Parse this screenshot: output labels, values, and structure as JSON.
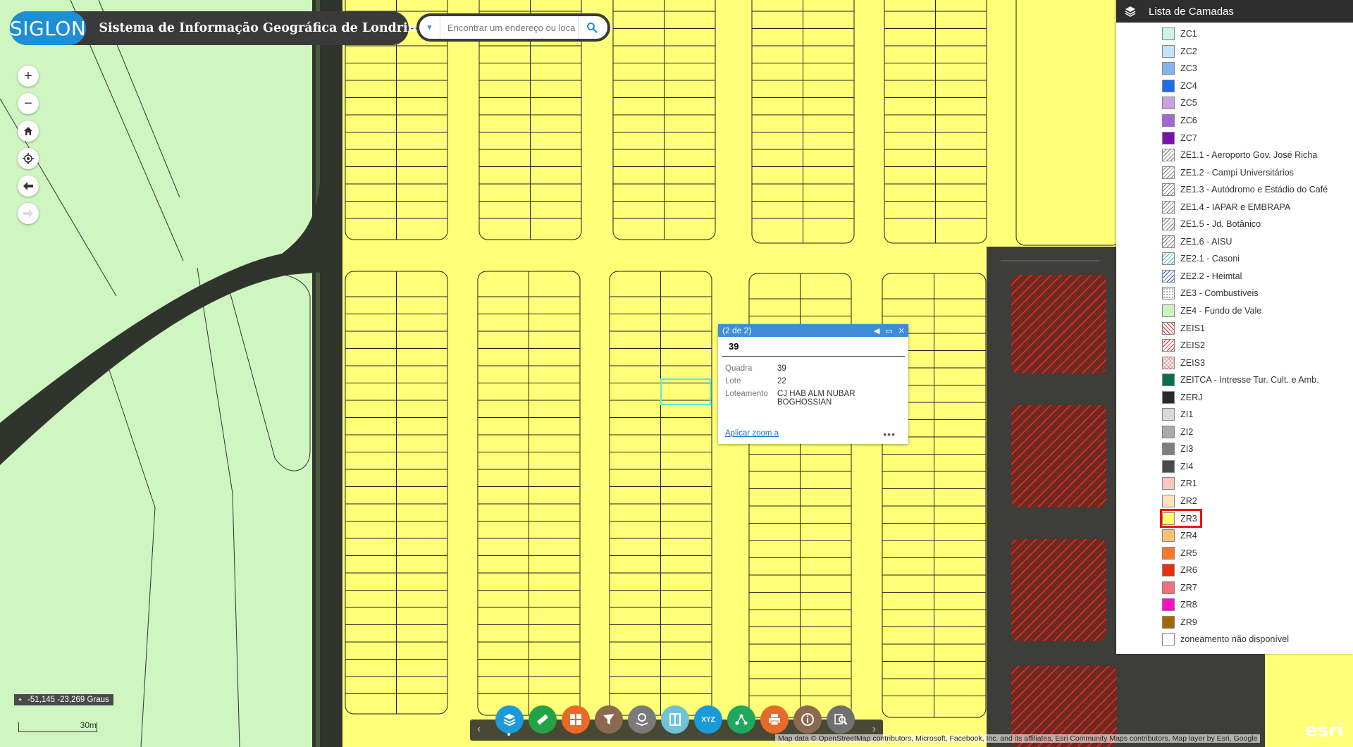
{
  "header": {
    "logo_text": "SIGLON",
    "title": "Sistema de Informação Geográfica de Londrina"
  },
  "search": {
    "placeholder": "Encontrar um endereço ou loca"
  },
  "controls": {
    "zoom_in": "+",
    "zoom_out": "−"
  },
  "popup": {
    "counter": "(2 de 2)",
    "title": "39",
    "fields": [
      {
        "key": "Quadra",
        "value": "39"
      },
      {
        "key": "Lote",
        "value": "22"
      },
      {
        "key": "Loteamento",
        "value": "CJ HAB ALM NUBAR BOGHOSSIAN"
      }
    ],
    "zoom_link": "Aplicar zoom a",
    "more": "•••"
  },
  "layer_list": {
    "title": "Lista de Camadas",
    "items": [
      {
        "label": "ZC1",
        "color": "#c8f5e6",
        "pattern": "solid"
      },
      {
        "label": "ZC2",
        "color": "#bfe4fb",
        "pattern": "solid"
      },
      {
        "label": "ZC3",
        "color": "#7fb6ee",
        "pattern": "solid"
      },
      {
        "label": "ZC4",
        "color": "#1e6ee8",
        "pattern": "solid"
      },
      {
        "label": "ZC5",
        "color": "#c9a0e0",
        "pattern": "solid"
      },
      {
        "label": "ZC6",
        "color": "#a468d4",
        "pattern": "solid"
      },
      {
        "label": "ZC7",
        "color": "#7a10b0",
        "pattern": "solid"
      },
      {
        "label": "ZE1.1 - Aeroporto Gov. José Richa",
        "color": "#777777",
        "pattern": "hatch"
      },
      {
        "label": "ZE1.2 - Campi Universitários",
        "color": "#777777",
        "pattern": "hatch"
      },
      {
        "label": "ZE1.3 - Autódromo e Estádio do Café",
        "color": "#777777",
        "pattern": "hatch"
      },
      {
        "label": "ZE1.4 - IAPAR e EMBRAPA",
        "color": "#777777",
        "pattern": "hatch"
      },
      {
        "label": "ZE1.5 - Jd. Botânico",
        "color": "#777777",
        "pattern": "hatch"
      },
      {
        "label": "ZE1.6 - AISU",
        "color": "#777777",
        "pattern": "hatch"
      },
      {
        "label": "ZE2.1 - Casoni",
        "color": "#3bb7d9",
        "pattern": "hatch"
      },
      {
        "label": "ZE2.2 - Heimtal",
        "color": "#1d56c9",
        "pattern": "hatch"
      },
      {
        "label": "ZE3 - Combustíveis",
        "color": "#888888",
        "pattern": "dots"
      },
      {
        "label": "ZE4 - Fundo de Vale",
        "color": "#cdf5c0",
        "pattern": "solid"
      },
      {
        "label": "ZEIS1",
        "color": "#e02020",
        "pattern": "hatch-rev"
      },
      {
        "label": "ZEIS2",
        "color": "#e02020",
        "pattern": "hatch"
      },
      {
        "label": "ZEIS3",
        "color": "#f08080",
        "pattern": "cross"
      },
      {
        "label": "ZEITCA - Intresse Tur. Cult. e Amb.",
        "color": "#0a6e4a",
        "pattern": "solid"
      },
      {
        "label": "ZERJ",
        "color": "#2a2a2a",
        "pattern": "solid"
      },
      {
        "label": "ZI1",
        "color": "#d9d9d9",
        "pattern": "solid"
      },
      {
        "label": "ZI2",
        "color": "#aaaaaa",
        "pattern": "solid"
      },
      {
        "label": "ZI3",
        "color": "#7e7e7e",
        "pattern": "solid"
      },
      {
        "label": "ZI4",
        "color": "#4a4a4a",
        "pattern": "solid"
      },
      {
        "label": "ZR1",
        "color": "#f8c8c0",
        "pattern": "solid"
      },
      {
        "label": "ZR2",
        "color": "#fde3c0",
        "pattern": "solid"
      },
      {
        "label": "ZR3",
        "color": "#ffff70",
        "pattern": "solid"
      },
      {
        "label": "ZR4",
        "color": "#fbc070",
        "pattern": "solid"
      },
      {
        "label": "ZR5",
        "color": "#f57a30",
        "pattern": "solid"
      },
      {
        "label": "ZR6",
        "color": "#e83010",
        "pattern": "solid"
      },
      {
        "label": "ZR7",
        "color": "#f07080",
        "pattern": "solid"
      },
      {
        "label": "ZR8",
        "color": "#ff10c8",
        "pattern": "solid"
      },
      {
        "label": "ZR9",
        "color": "#a06a00",
        "pattern": "solid"
      },
      {
        "label": "zoneamento não disponível",
        "color": "#ffffff",
        "pattern": "solid"
      }
    ]
  },
  "coordinates": "-51,145 -23,269 Graus",
  "scale_label": "30m",
  "toolbar": {
    "tools": [
      {
        "name": "layers-tool",
        "color": "#1a9ad8"
      },
      {
        "name": "measure-tool",
        "color": "#26a246"
      },
      {
        "name": "grid-tool",
        "color": "#e86a28"
      },
      {
        "name": "filter-tool",
        "color": "#8a6a50"
      },
      {
        "name": "location-tool",
        "color": "#7a7a7a"
      },
      {
        "name": "swipe-tool",
        "color": "#6fc3d6"
      },
      {
        "name": "xyz-tool",
        "color": "#1a9ad8"
      },
      {
        "name": "share-tool",
        "color": "#20a860"
      },
      {
        "name": "print-tool",
        "color": "#e86a28"
      },
      {
        "name": "info-tool",
        "color": "#8a6a50"
      },
      {
        "name": "search-map-tool",
        "color": "#707070"
      }
    ],
    "xyz_label": "XYZ"
  },
  "attribution": "Map data © OpenStreetMap contributors, Microsoft, Facebook, Inc. and its affiliates, Esri Community Maps contributors, Map layer by Esri, Google",
  "esri_logo": "esri",
  "colors": {
    "zone_yellow": "#ffff78",
    "greenland": "#cff5c0",
    "road": "#2a2e2a",
    "accent": "#1c8fd6"
  }
}
